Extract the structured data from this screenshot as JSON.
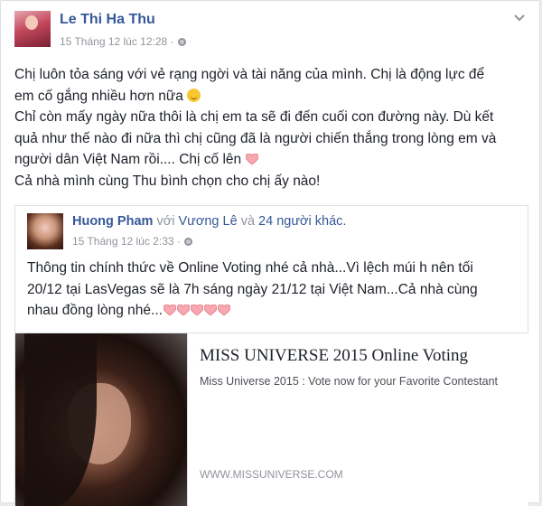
{
  "post": {
    "author": "Le Thi Ha Thu",
    "timestamp": "15 Tháng 12 lúc 12:28 ·",
    "privacy_icon": "globe-icon",
    "lines": [
      "Chị luôn tỏa sáng với vẻ rạng ngời và tài năng của mình. Chị là động lực để",
      "em cố gắng nhiều hơn nữa",
      "Chỉ còn mấy ngày nữa thôi là chị em ta sẽ đi đến cuối con đường này. Dù kết",
      "quả như thế nào đi nữa thì chị cũng đã là người chiến thắng trong lòng em và",
      "người dân Việt Nam rồi.... Chị cố lên",
      "Cả nhà mình cùng Thu bình chọn cho chị ấy nào!"
    ]
  },
  "shared": {
    "author": "Huong Pham",
    "with_word": "với",
    "tagged": "Vương Lê",
    "and_word": "và",
    "others": "24 người khác.",
    "timestamp": "15 Tháng 12 lúc 2:33 ·",
    "lines": [
      "Thông tin chính thức về Online Voting nhé cả nhà...Vì lệch múi h nên tối",
      "20/12 tại LasVegas sẽ là 7h sáng ngày 21/12 tại Việt Nam...Cả nhà cùng",
      "nhau đồng lòng nhé..."
    ],
    "link": {
      "title": "MISS UNIVERSE 2015 Online Voting",
      "description": "Miss Universe 2015 : Vote now for your Favorite Contestant",
      "domain": "WWW.MISSUNIVERSE.COM"
    }
  },
  "colors": {
    "link": "#365899",
    "meta": "#90949c",
    "text": "#1d2129",
    "heart": "#f7a8b0"
  }
}
